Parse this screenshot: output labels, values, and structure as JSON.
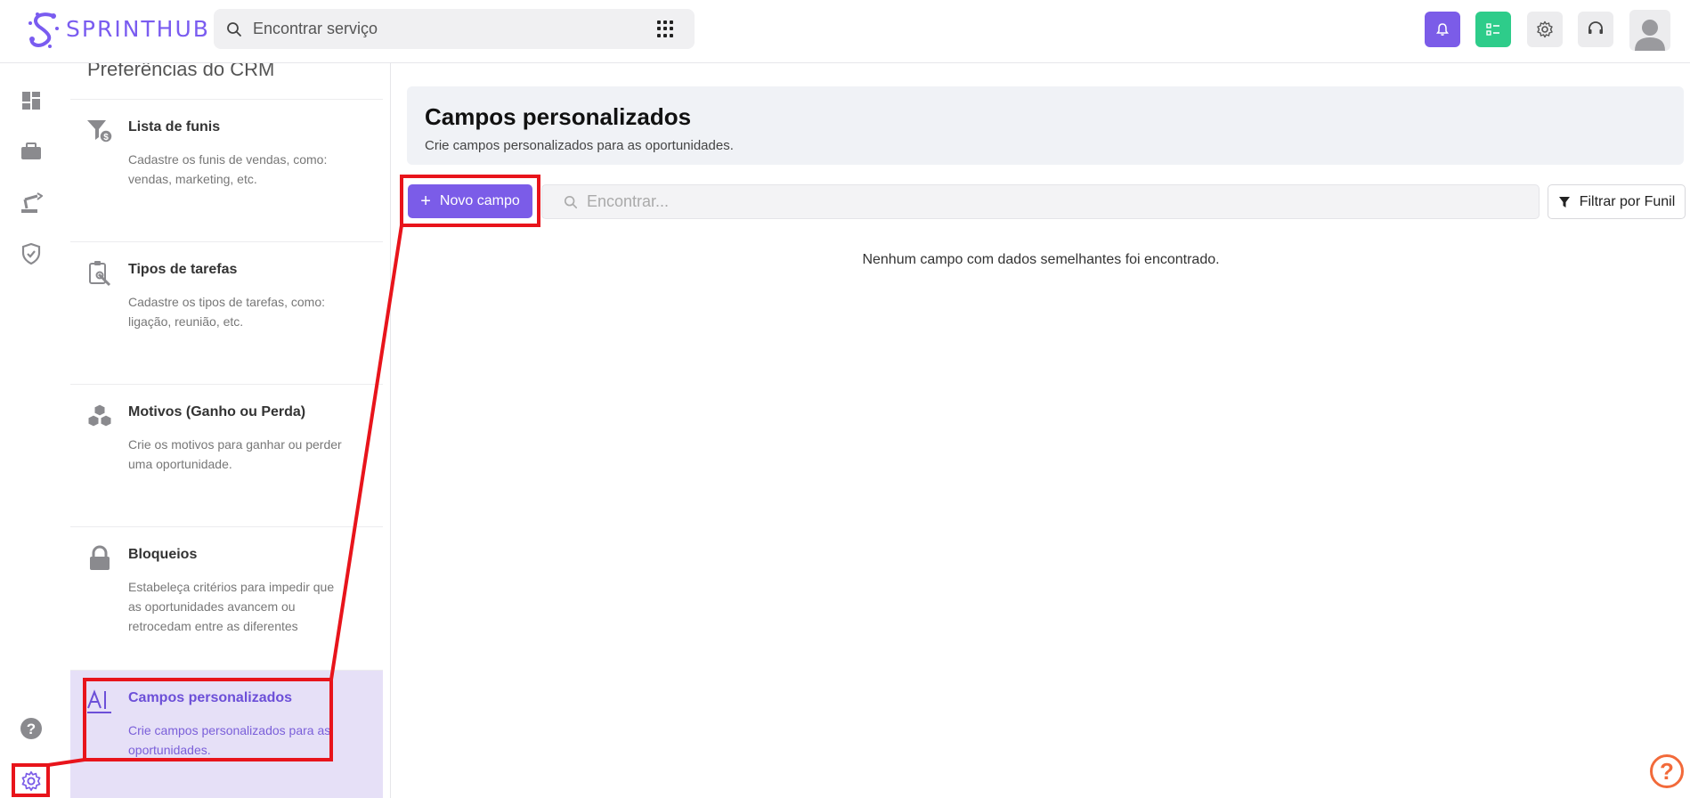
{
  "app": {
    "logo_text": "SPRINTHUB"
  },
  "topbar": {
    "search_placeholder": "Encontrar serviço",
    "icons": [
      "search-icon",
      "apps-grid-icon",
      "bell-icon",
      "checklist-icon",
      "gear-icon",
      "headset-icon",
      "user-avatar-icon"
    ],
    "bell_color": "#7b5ce8",
    "checklist_color": "#2ecc8a"
  },
  "leftnav": {
    "icons": [
      "dashboard-icon",
      "briefcase-icon",
      "robot-arm-icon",
      "shield-check-icon",
      "help-circle-icon",
      "settings-gear-icon"
    ]
  },
  "sidepanel": {
    "title": "Preferências do CRM",
    "items": [
      {
        "title": "Lista de funis",
        "desc": "Cadastre os funis de vendas, como: vendas, marketing, etc.",
        "icon": "funnel-dollar-icon"
      },
      {
        "title": "Tipos de tarefas",
        "desc": "Cadastre os tipos de tarefas, como: ligação, reunião, etc.",
        "icon": "clipboard-tools-icon"
      },
      {
        "title": "Motivos (Ganho ou Perda)",
        "desc": "Crie os motivos para ganhar ou perder uma oportunidade.",
        "icon": "cubes-icon"
      },
      {
        "title": "Bloqueios",
        "desc": "Estabeleça critérios para impedir que as oportunidades avancem ou retrocedam entre as diferentes",
        "icon": "lock-icon"
      },
      {
        "title": "Campos personalizados",
        "desc": "Crie campos personalizados para as oportunidades.",
        "icon": "text-field-icon",
        "active": true
      }
    ]
  },
  "main": {
    "title": "Campos personalizados",
    "subtitle": "Crie campos personalizados para as oportunidades.",
    "new_button": "Novo campo",
    "find_placeholder": "Encontrar...",
    "filter_button": "Filtrar por Funil",
    "empty_message": "Nenhum campo com dados semelhantes foi encontrado."
  },
  "colors": {
    "accent": "#7b5ce8",
    "annotation": "#e8141b",
    "help_fab": "#f26a3a"
  },
  "help_fab": "?"
}
